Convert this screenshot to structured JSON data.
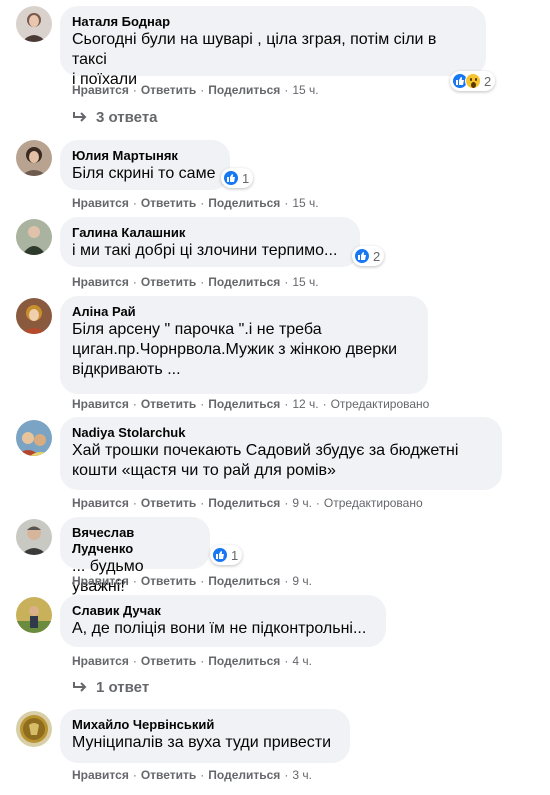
{
  "comments": [
    {
      "author": "Наталя Боднар",
      "text": "Сьогодні були на шуварі , ціла зграя, потім сіли в таксі\nі поїхали",
      "reaction_count": "2",
      "reactions": [
        "like-icon",
        "wow-icon"
      ],
      "actions": {
        "like": "Нравится",
        "reply": "Ответить",
        "share": "Поделиться",
        "time": "15 ч."
      },
      "replies": "3 ответа"
    },
    {
      "author": "Юлия Мартыняк",
      "text": "Біля скрині то саме",
      "reaction_count": "1",
      "reactions": [
        "like-icon"
      ],
      "actions": {
        "like": "Нравится",
        "reply": "Ответить",
        "share": "Поделиться",
        "time": "15 ч."
      }
    },
    {
      "author": "Галина Калашник",
      "text": "і ми такі добрі ці злочини терпимо...",
      "reaction_count": "2",
      "reactions": [
        "like-icon"
      ],
      "actions": {
        "like": "Нравится",
        "reply": "Ответить",
        "share": "Поделиться",
        "time": "15 ч."
      }
    },
    {
      "author": "Аліна Рай",
      "text": "Біля арсену \" парочка \".і не треба\nциган.пр.Чорнрвола.Мужик з жінкою дверки\nвідкривають ...",
      "actions": {
        "like": "Нравится",
        "reply": "Ответить",
        "share": "Поделиться",
        "time": "12 ч.",
        "edited": "Отредактировано"
      }
    },
    {
      "author": "Nadiya Stolarchuk",
      "text": "Хай трошки почекають Садовий збудує за бюджетні\nкошти «щастя чи то рай для ромів»",
      "actions": {
        "like": "Нравится",
        "reply": "Ответить",
        "share": "Поделиться",
        "time": "9 ч.",
        "edited": "Отредактировано"
      }
    },
    {
      "author": "Вячеслав Лудченко",
      "text": "... будьмо уважні!",
      "reaction_count": "1",
      "reactions": [
        "like-icon"
      ],
      "actions": {
        "like": "Нравится",
        "reply": "Ответить",
        "share": "Поделиться",
        "time": "9 ч."
      }
    },
    {
      "author": "Славик Дучак",
      "text": "А, де поліція вони їм не підконтрольні...",
      "actions": {
        "like": "Нравится",
        "reply": "Ответить",
        "share": "Поделиться",
        "time": "4 ч."
      },
      "replies": "1 ответ"
    },
    {
      "author": "Михайло Червінський",
      "text": "Муніципалів за вуха туди привести",
      "actions": {
        "like": "Нравится",
        "reply": "Ответить",
        "share": "Поделиться",
        "time": "3 ч."
      }
    }
  ],
  "colors": {
    "bubble": "#f0f2f5",
    "secondary_text": "#65676b",
    "like_blue": "#1877f2"
  }
}
